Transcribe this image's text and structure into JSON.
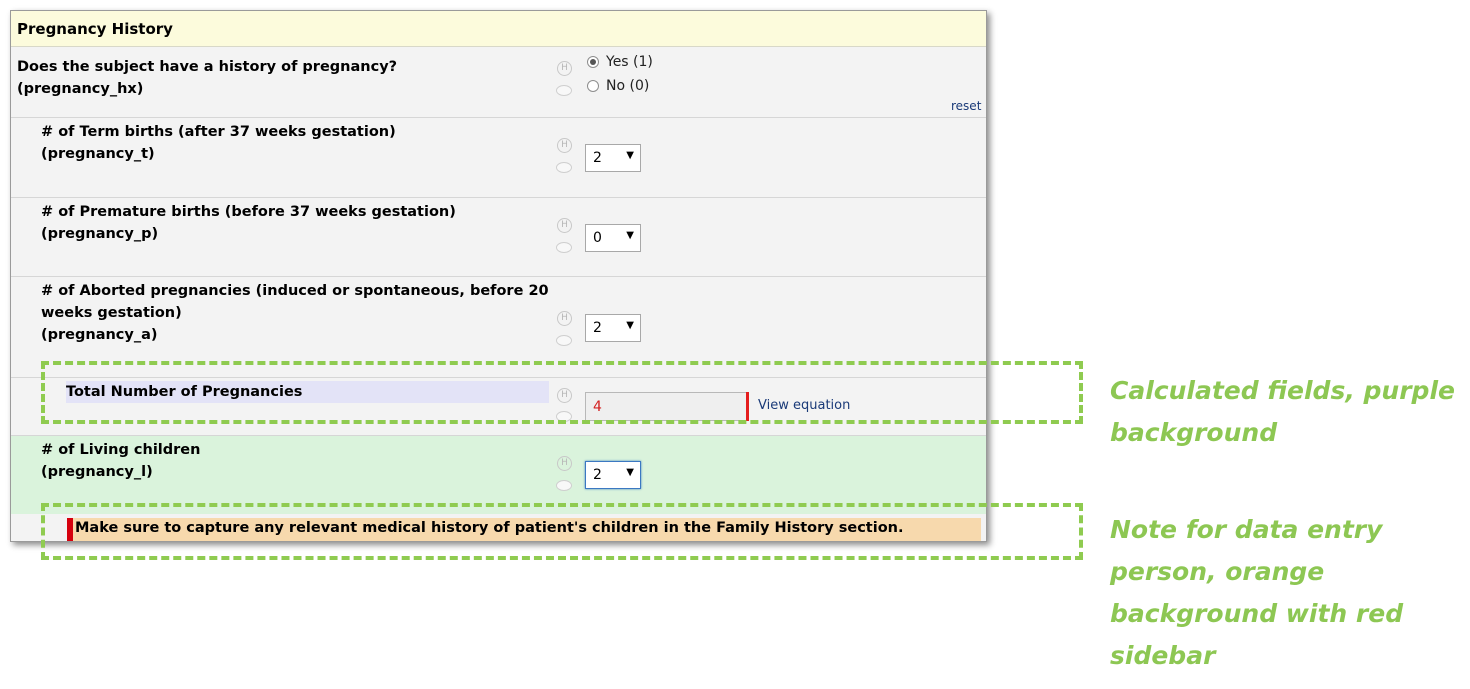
{
  "section": {
    "title": "Pregnancy History"
  },
  "q_hx": {
    "line1": "Does the subject have a history of pregnancy?",
    "line2": "(pregnancy_hx)",
    "options": [
      "Yes (1)",
      "No (0)"
    ],
    "selected": "Yes (1)",
    "reset": "reset"
  },
  "q_t": {
    "line1": "# of Term births (after 37 weeks gestation)",
    "line2": "(pregnancy_t)",
    "value": "2"
  },
  "q_p": {
    "line1": "# of Premature births (before 37 weeks gestation)",
    "line2": "(pregnancy_p)",
    "value": "0"
  },
  "q_a": {
    "line1": "# of Aborted pregnancies (induced or spontaneous, before 20",
    "line2": "weeks gestation)",
    "line3": "(pregnancy_a)",
    "value": "2"
  },
  "q_total": {
    "label": "Total Number of Pregnancies",
    "value": "4",
    "link": "View equation"
  },
  "q_l": {
    "line1": "# of Living children",
    "line2": "(pregnancy_l)",
    "value": "2"
  },
  "note": {
    "text": "Make sure to capture any relevant medical history of patient's children in the Family History section."
  },
  "icons": {
    "help": "H",
    "help_icon": "help-icon",
    "comment_icon": "comment-icon",
    "dropdown": "▼"
  },
  "annotations": {
    "calc": [
      "Calculated fields, purple",
      "background"
    ],
    "note": [
      "Note for data entry",
      "person, orange",
      "background with red",
      "sidebar"
    ]
  },
  "colors": {
    "annotation": "#8dc753",
    "calc_bg": "#e3e3f7",
    "note_bg": "#f7d9ad",
    "note_bar": "#d6000e",
    "green_row": "#daf3dc"
  }
}
